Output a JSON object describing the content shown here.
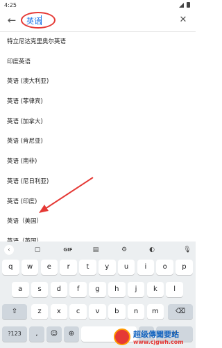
{
  "status_bar": {
    "time": "4:25"
  },
  "search": {
    "value": "英语"
  },
  "list": [
    "特立尼达克里奥尔英语",
    "印度英语",
    "英语 (澳大利亚)",
    "英语 (菲律宾)",
    "英语 (加拿大)",
    "英语 (肯尼亚)",
    "英语 (南非)",
    "英语 (尼日利亚)",
    "英语 (印度)",
    "英语（美国）",
    "英语（英国）"
  ],
  "keyboard": {
    "toolbar": {
      "gif": "GIF"
    },
    "row1": [
      "q",
      "w",
      "e",
      "r",
      "t",
      "y",
      "u",
      "i",
      "o",
      "p"
    ],
    "row2": [
      "a",
      "s",
      "d",
      "f",
      "g",
      "h",
      "j",
      "k",
      "l"
    ],
    "row3": [
      "z",
      "x",
      "c",
      "v",
      "b",
      "n",
      "m"
    ],
    "sym": "?123",
    "comma": ",",
    "period": ".",
    "enter": "↵",
    "shift": "⇧",
    "backspace": "⌫",
    "emoji": "☺",
    "globe": "⊕"
  },
  "watermark": {
    "name": "超级傳聞要站",
    "url": "www.cjgwh.com"
  },
  "colors": {
    "accent": "#1a73e8",
    "annotation": "#e53935",
    "keyboard_bg": "#eceff1"
  }
}
